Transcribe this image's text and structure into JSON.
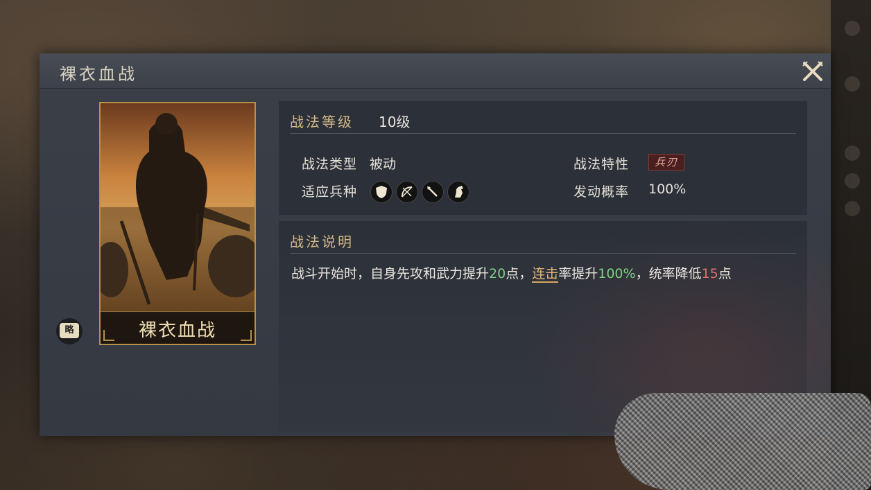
{
  "dialog": {
    "title": "裸衣血战"
  },
  "card": {
    "name": "裸衣血战"
  },
  "brief_button": {
    "label": "略"
  },
  "level": {
    "label": "战法等级",
    "value": "10级"
  },
  "attributes": {
    "type_label": "战法类型",
    "type_value": "被动",
    "trait_label": "战法特性",
    "trait_value": "兵刃",
    "troops_label": "适应兵种",
    "troops_icons": [
      "shield-icon",
      "bow-icon",
      "spear-icon",
      "horse-icon"
    ],
    "rate_label": "发动概率",
    "rate_value": "100%"
  },
  "description": {
    "header": "战法说明",
    "parts": {
      "p1": "战斗开始时，自身先攻和武力提升",
      "n1": "20",
      "p2": "点，",
      "link": "连击",
      "p3": "率提升",
      "n2": "100%",
      "p4": "，统率降低",
      "n3": "15",
      "p5": "点"
    }
  },
  "colors": {
    "accent_gold": "#d3b98a",
    "positive_green": "#7fcf86",
    "negative_red": "#e16e6e",
    "link_orange": "#e3b872"
  }
}
